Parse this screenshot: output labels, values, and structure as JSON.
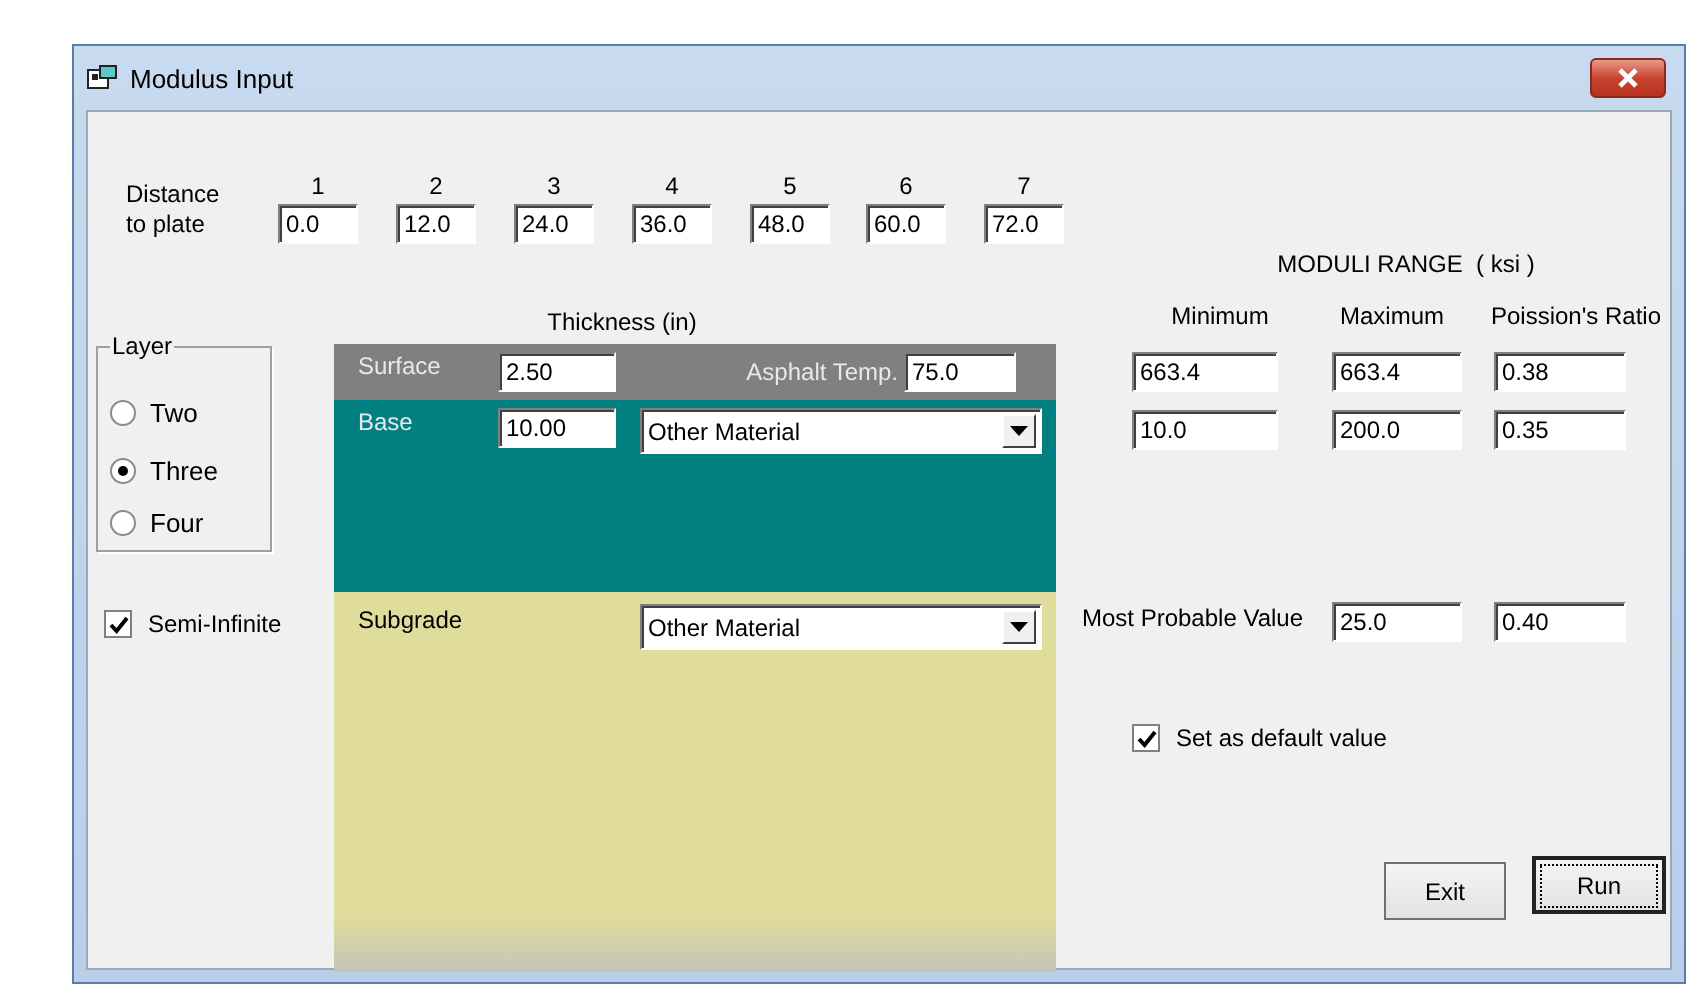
{
  "window": {
    "title": "Modulus Input"
  },
  "distance": {
    "label": "Distance to plate",
    "points": [
      {
        "number": "1",
        "value": "0.0"
      },
      {
        "number": "2",
        "value": "12.0"
      },
      {
        "number": "3",
        "value": "24.0"
      },
      {
        "number": "4",
        "value": "36.0"
      },
      {
        "number": "5",
        "value": "48.0"
      },
      {
        "number": "6",
        "value": "60.0"
      },
      {
        "number": "7",
        "value": "72.0"
      }
    ]
  },
  "layer_group": {
    "legend": "Layer",
    "options": [
      {
        "label": "Two",
        "selected": false
      },
      {
        "label": "Three",
        "selected": true
      },
      {
        "label": "Four",
        "selected": false
      }
    ]
  },
  "semi_infinite": {
    "label": "Semi-Infinite",
    "checked": true
  },
  "thickness_header": "Thickness (in)",
  "layers": [
    {
      "kind": "surface",
      "name": "Surface",
      "color": "#808080",
      "thickness": "2.50",
      "temp_label": "Asphalt Temp.",
      "temp_value": "75.0"
    },
    {
      "kind": "base",
      "name": "Base",
      "color": "#008080",
      "thickness": "10.00",
      "material": "Other Material"
    },
    {
      "kind": "subgrade",
      "name": "Subgrade",
      "color": "#e0dc9c",
      "material": "Other Material"
    }
  ],
  "moduli": {
    "title": "MODULI RANGE  ( ksi )",
    "columns": [
      "Minimum",
      "Maximum",
      "Poission's Ratio"
    ],
    "rows": [
      [
        "663.4",
        "663.4",
        "0.38"
      ],
      [
        "10.0",
        "200.0",
        "0.35"
      ]
    ]
  },
  "most_probable": {
    "label": "Most Probable Value",
    "values": [
      "25.0",
      "0.40"
    ]
  },
  "default_checkbox": {
    "label": "Set as default value",
    "checked": true
  },
  "buttons": [
    {
      "label": "Exit",
      "focused": false
    },
    {
      "label": "Run",
      "focused": true
    }
  ]
}
